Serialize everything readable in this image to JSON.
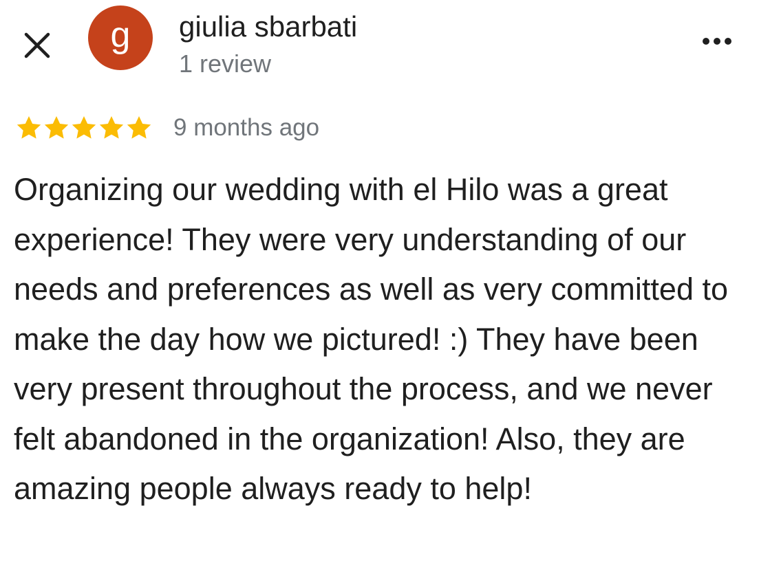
{
  "header": {
    "close_icon": "close-icon",
    "avatar_letter": "g",
    "avatar_color": "#c5421b",
    "reviewer_name": "giulia sbarbati",
    "review_count": "1 review",
    "more_icon": "more-horiz-icon"
  },
  "review": {
    "rating": 5,
    "max_rating": 5,
    "star_color": "#fbbc04",
    "date": "9 months ago",
    "text": "Organizing our wedding with el Hilo was a great experience! They were very understanding of our needs and preferences as well as very committed to make the day how we pictured! :) They have been very present throughout the process, and we never felt abandoned in the organization! Also, they are amazing people always ready to help!"
  }
}
